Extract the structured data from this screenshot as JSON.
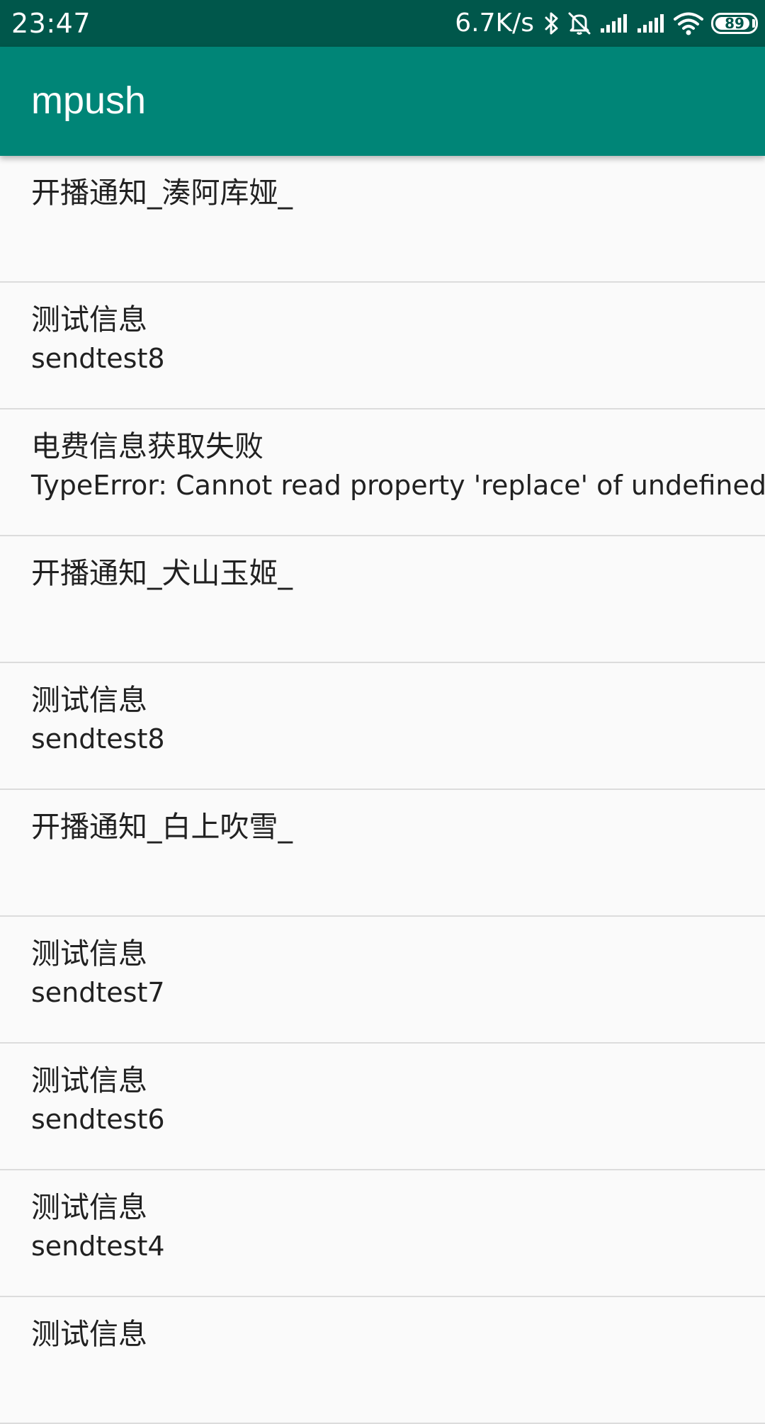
{
  "status_bar": {
    "time": "23:47",
    "net_speed": "6.7K/s",
    "battery_level": "89",
    "battery_percent": 89,
    "icons": [
      "bluetooth-icon",
      "mute-icon",
      "signal-icon",
      "signal-icon",
      "wifi-icon",
      "battery-icon"
    ]
  },
  "app_bar": {
    "title": "mpush",
    "color": "#008577"
  },
  "colors": {
    "status_bar": "#00574b",
    "app_bar": "#008577",
    "background": "#fafafa",
    "divider": "#dcdcdc"
  },
  "messages": [
    {
      "title": "开播通知_湊阿库娅_",
      "body": ""
    },
    {
      "title": "测试信息",
      "body": "sendtest8"
    },
    {
      "title": "电费信息获取失败",
      "body": "TypeError: Cannot read property 'replace' of undefined"
    },
    {
      "title": "开播通知_犬山玉姬_",
      "body": ""
    },
    {
      "title": "测试信息",
      "body": "sendtest8"
    },
    {
      "title": "开播通知_白上吹雪_",
      "body": ""
    },
    {
      "title": "测试信息",
      "body": "sendtest7"
    },
    {
      "title": "测试信息",
      "body": "sendtest6"
    },
    {
      "title": "测试信息",
      "body": "sendtest4"
    },
    {
      "title": "测试信息",
      "body": ""
    }
  ]
}
